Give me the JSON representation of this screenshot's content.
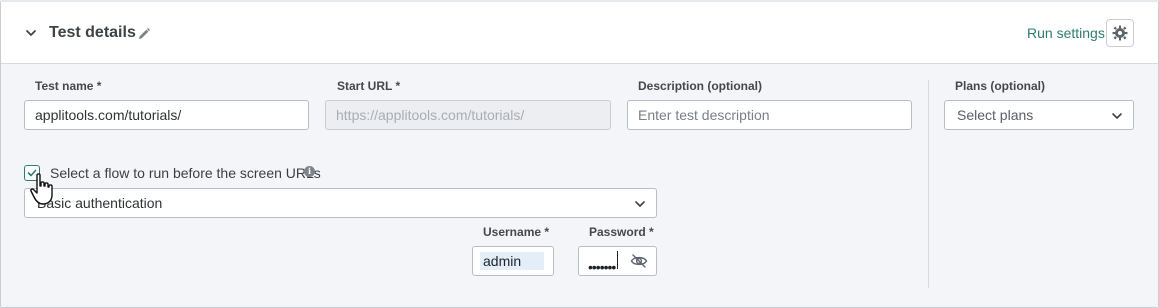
{
  "header": {
    "title": "Test details",
    "run_settings_label": "Run settings"
  },
  "fields": {
    "test_name": {
      "label": "Test name *",
      "value": "applitools.com/tutorials/"
    },
    "start_url": {
      "label": "Start URL *",
      "value": "https://applitools.com/tutorials/"
    },
    "description": {
      "label": "Description (optional)",
      "placeholder": "Enter test description"
    },
    "plans": {
      "label": "Plans (optional)",
      "placeholder": "Select plans"
    }
  },
  "flow": {
    "checkbox_label": "Select a flow to run before the screen URLs",
    "checked": true,
    "selected": "Basic authentication"
  },
  "auth": {
    "username_label": "Username *",
    "username_value": "admin",
    "password_label": "Password *",
    "password_value": "•••••••"
  },
  "icons": {
    "collapse": "chevron-down-icon",
    "edit": "pencil-icon",
    "settings": "gear-icon",
    "info": "info-icon",
    "toggle_visibility": "eye-off-icon"
  },
  "colors": {
    "accent": "#2e7b74",
    "header_bg": "#ffffff",
    "body_bg": "#f3f5f8"
  }
}
